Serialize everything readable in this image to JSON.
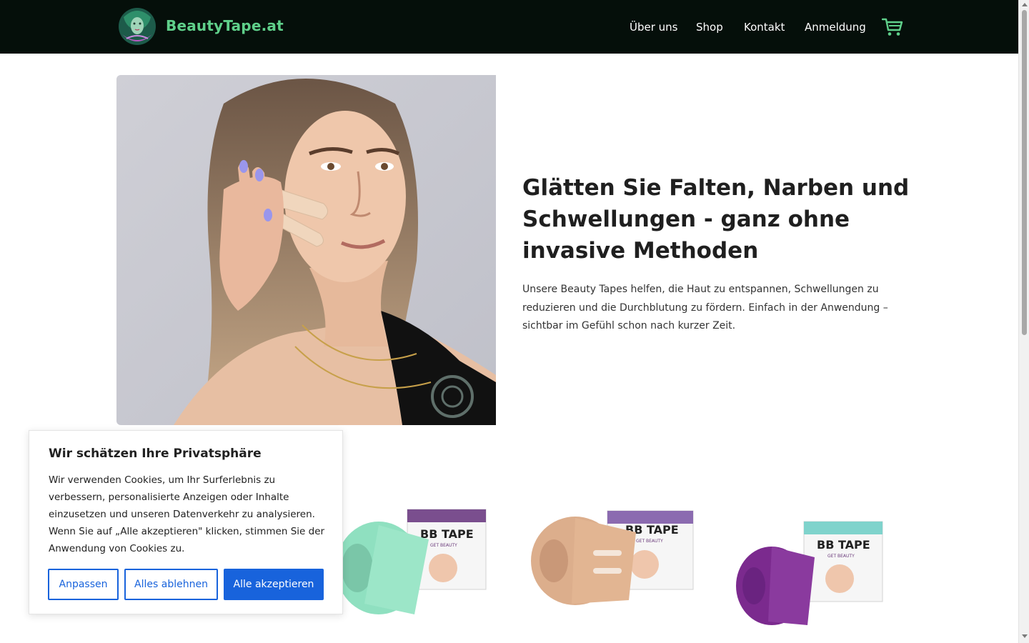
{
  "header": {
    "brand": "BeautyTape.at",
    "nav": [
      "Über uns",
      "Shop",
      "Kontakt",
      "Anmeldung"
    ],
    "cart_icon": "shopping-cart-icon",
    "background": "#050f0a",
    "brand_color": "#5fd08a"
  },
  "hero": {
    "title": "Glätten Sie Falten, Narben und Schwellungen - ganz ohne invasive Methoden",
    "text": "Unsere Beauty Tapes helfen, die Haut zu entspannen, Schwellungen zu reduzieren und die Durchblutung zu fördern. Einfach in der Anwendung – sichtbar im Gefühl schon nach kurzer Zeit."
  },
  "products": [
    {
      "brand": "BB TAPE",
      "sub": "GET BEAUTY",
      "color": "#8fe0c0"
    },
    {
      "brand": "BB TAPE",
      "sub": "GET BEAUTY",
      "color": "#dcae8c"
    },
    {
      "brand": "BB TAPE",
      "sub": "GET BEAUTY",
      "color": "#7b2a8e"
    }
  ],
  "cookie": {
    "title": "Wir schätzen Ihre Privatsphäre",
    "text": "Wir verwenden Cookies, um Ihr Surferlebnis zu verbessern, personalisierte Anzeigen oder Inhalte einzusetzen und unseren Datenverkehr zu analysieren. Wenn Sie auf „Alle akzeptieren\" klicken, stimmen Sie der Anwendung von Cookies zu.",
    "customize": "Anpassen",
    "reject": "Alles ablehnen",
    "accept": "Alle akzeptieren",
    "accent": "#1863dc"
  }
}
